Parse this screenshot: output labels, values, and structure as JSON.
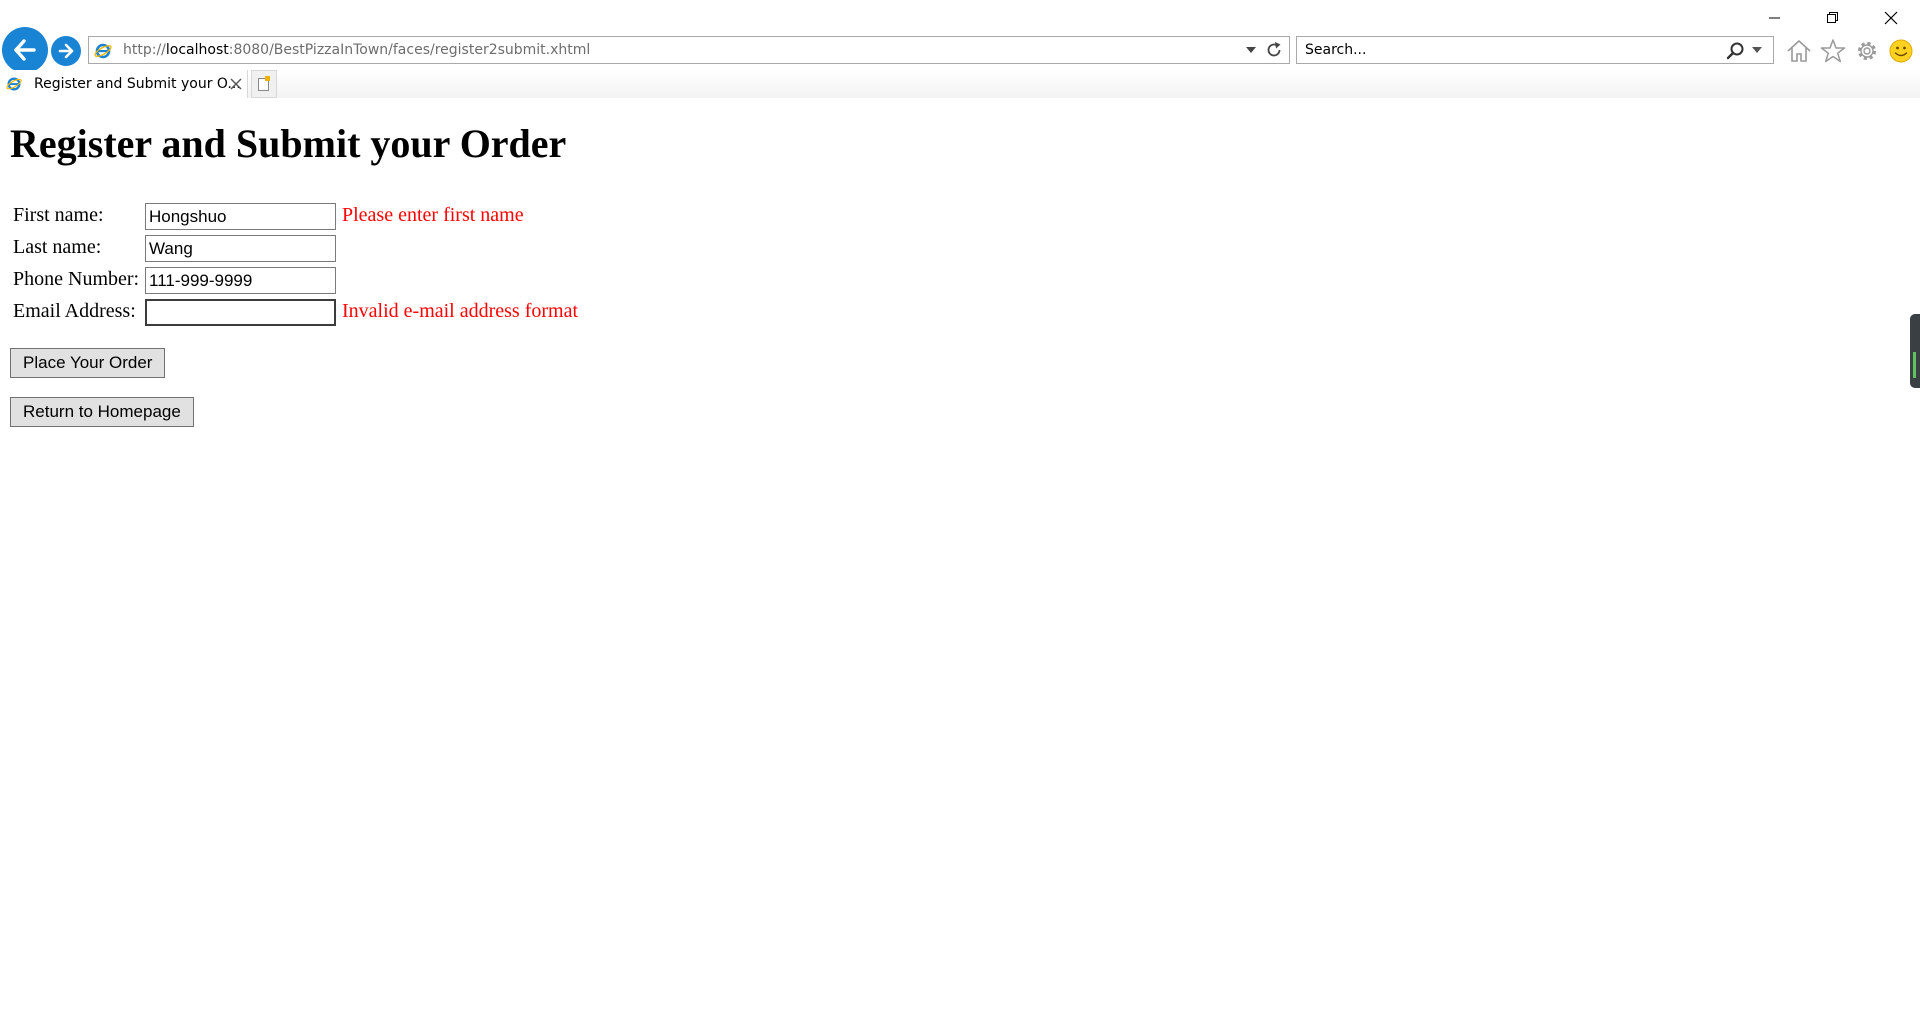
{
  "browser": {
    "url_prefix": "http://",
    "url_host": "localhost",
    "url_rest": ":8080/BestPizzaInTown/faces/register2submit.xhtml",
    "search_placeholder": "Search...",
    "tab_title": "Register and Submit your O...",
    "icons": {
      "back": "back-arrow-icon",
      "forward": "forward-arrow-icon",
      "refresh": "refresh-icon",
      "search": "search-icon",
      "home": "home-icon",
      "favorites": "star-icon",
      "tools": "gear-icon",
      "feedback": "smiley-icon"
    },
    "colors": {
      "nav_blue": "#1a84d4"
    }
  },
  "page": {
    "title": "Register and Submit your Order",
    "form": {
      "first_name": {
        "label": "First name:",
        "value": "Hongshuo",
        "error": "Please enter first name"
      },
      "last_name": {
        "label": "Last name:",
        "value": "Wang"
      },
      "phone": {
        "label": "Phone Number:",
        "value": "111-999-9999"
      },
      "email": {
        "label": "Email Address:",
        "value": "",
        "error": "Invalid e-mail address format"
      }
    },
    "buttons": {
      "place_order": "Place Your Order",
      "return_home": "Return to Homepage"
    },
    "colors": {
      "error": "#ff0000"
    }
  }
}
